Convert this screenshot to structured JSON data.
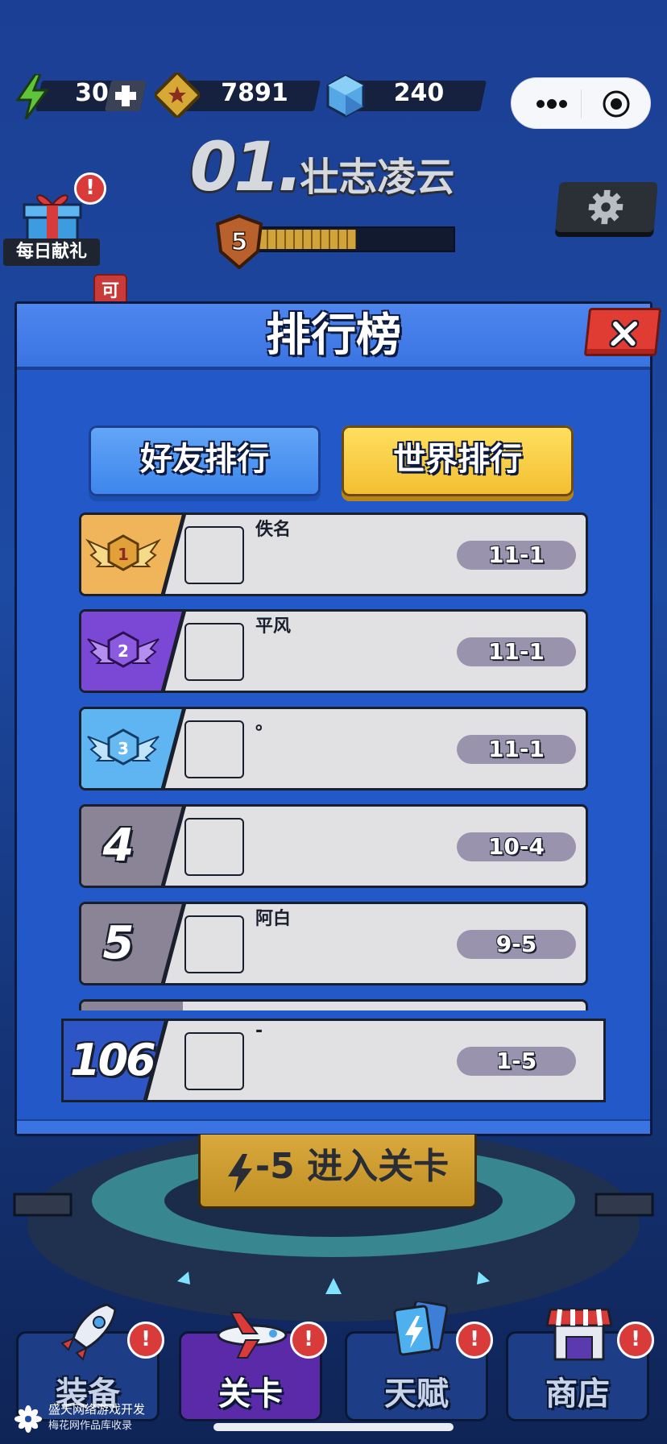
{
  "hud": {
    "energy": "30",
    "coins": "7891",
    "gems": "240",
    "energy_icon": "lightning-icon",
    "coin_icon": "coin-star-icon",
    "gem_icon": "hex-gem-icon"
  },
  "level": {
    "number": "01.",
    "name": "壮志凌云",
    "rank": "5",
    "progress": 0.5
  },
  "side": {
    "gift_label": "每日献礼",
    "gift_badge": "!",
    "side_badge": "可"
  },
  "leaderboard": {
    "title": "排行榜",
    "tabs": [
      "好友排行",
      "世界排行"
    ],
    "rows": [
      {
        "rank": "1",
        "name": "佚名",
        "score": "11-1"
      },
      {
        "rank": "2",
        "name": "平风",
        "score": "11-1"
      },
      {
        "rank": "3",
        "name": "。",
        "score": "11-1"
      },
      {
        "rank": "4",
        "name": "",
        "score": "10-4"
      },
      {
        "rank": "5",
        "name": "阿白",
        "score": "9-5"
      }
    ],
    "self": {
      "rank": "106",
      "name": "-",
      "score": "1-5"
    }
  },
  "enter_button": "-5 进入关卡",
  "nav": [
    {
      "label": "装备",
      "badge": "!"
    },
    {
      "label": "关卡",
      "badge": "!"
    },
    {
      "label": "天赋",
      "badge": "!"
    },
    {
      "label": "商店",
      "badge": "!"
    }
  ],
  "watermark": {
    "line1": "盛天网络游戏开发",
    "line2": "梅花网作品库收录"
  },
  "colors": {
    "background": "#1d4aa3",
    "panel": "#2358c8",
    "gold_rank": "#f0b45a",
    "purple_rank": "#7b48d6",
    "blue_rank": "#5fb4f2",
    "grey_rank": "#8b8496",
    "self_rank": "#2d55c6",
    "close": "#e13c33"
  }
}
